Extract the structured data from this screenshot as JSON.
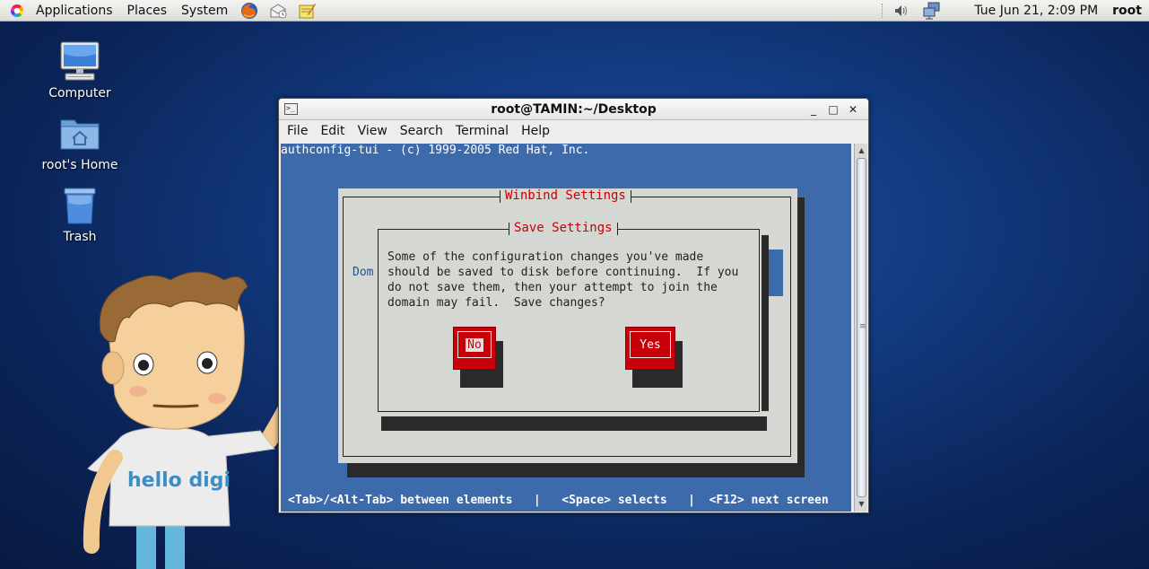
{
  "panel": {
    "menus": [
      "Applications",
      "Places",
      "System"
    ],
    "clock": "Tue Jun 21,  2:09 PM",
    "user": "root",
    "launchers": [
      "firefox-icon",
      "mail-icon",
      "notes-icon"
    ],
    "tray": [
      "volume-icon",
      "network-icon"
    ]
  },
  "desktop": {
    "icons": [
      {
        "label": "Computer",
        "icon": "computer-icon"
      },
      {
        "label": "root's Home",
        "icon": "home-folder-icon"
      },
      {
        "label": "Trash",
        "icon": "trash-icon"
      }
    ],
    "mascot_text": "hello digi"
  },
  "window": {
    "title": "root@TAMIN:~/Desktop",
    "controls": [
      "_",
      "□",
      "✕"
    ],
    "menu": [
      "File",
      "Edit",
      "View",
      "Search",
      "Terminal",
      "Help"
    ]
  },
  "terminal": {
    "header": "authconfig-tui - (c) 1999-2005 Red Hat, Inc.",
    "outer_dialog_title": "Winbind Settings",
    "partial_label": "Dom",
    "inner_dialog_title": "Save Settings",
    "message": "Some of the configuration changes you've made\nshould be saved to disk before continuing.  If you\ndo not save them, then your attempt to join the\ndomain may fail.  Save changes?",
    "buttons": {
      "no": "No",
      "yes": "Yes"
    },
    "hints": "<Tab>/<Alt-Tab> between elements   |   <Space> selects   |  <F12> next screen"
  },
  "colors": {
    "terminal_bg": "#3d6aaa",
    "dialog_bg": "#d5d7d2",
    "button_red": "#c8000a",
    "title_red": "#cc0000"
  }
}
